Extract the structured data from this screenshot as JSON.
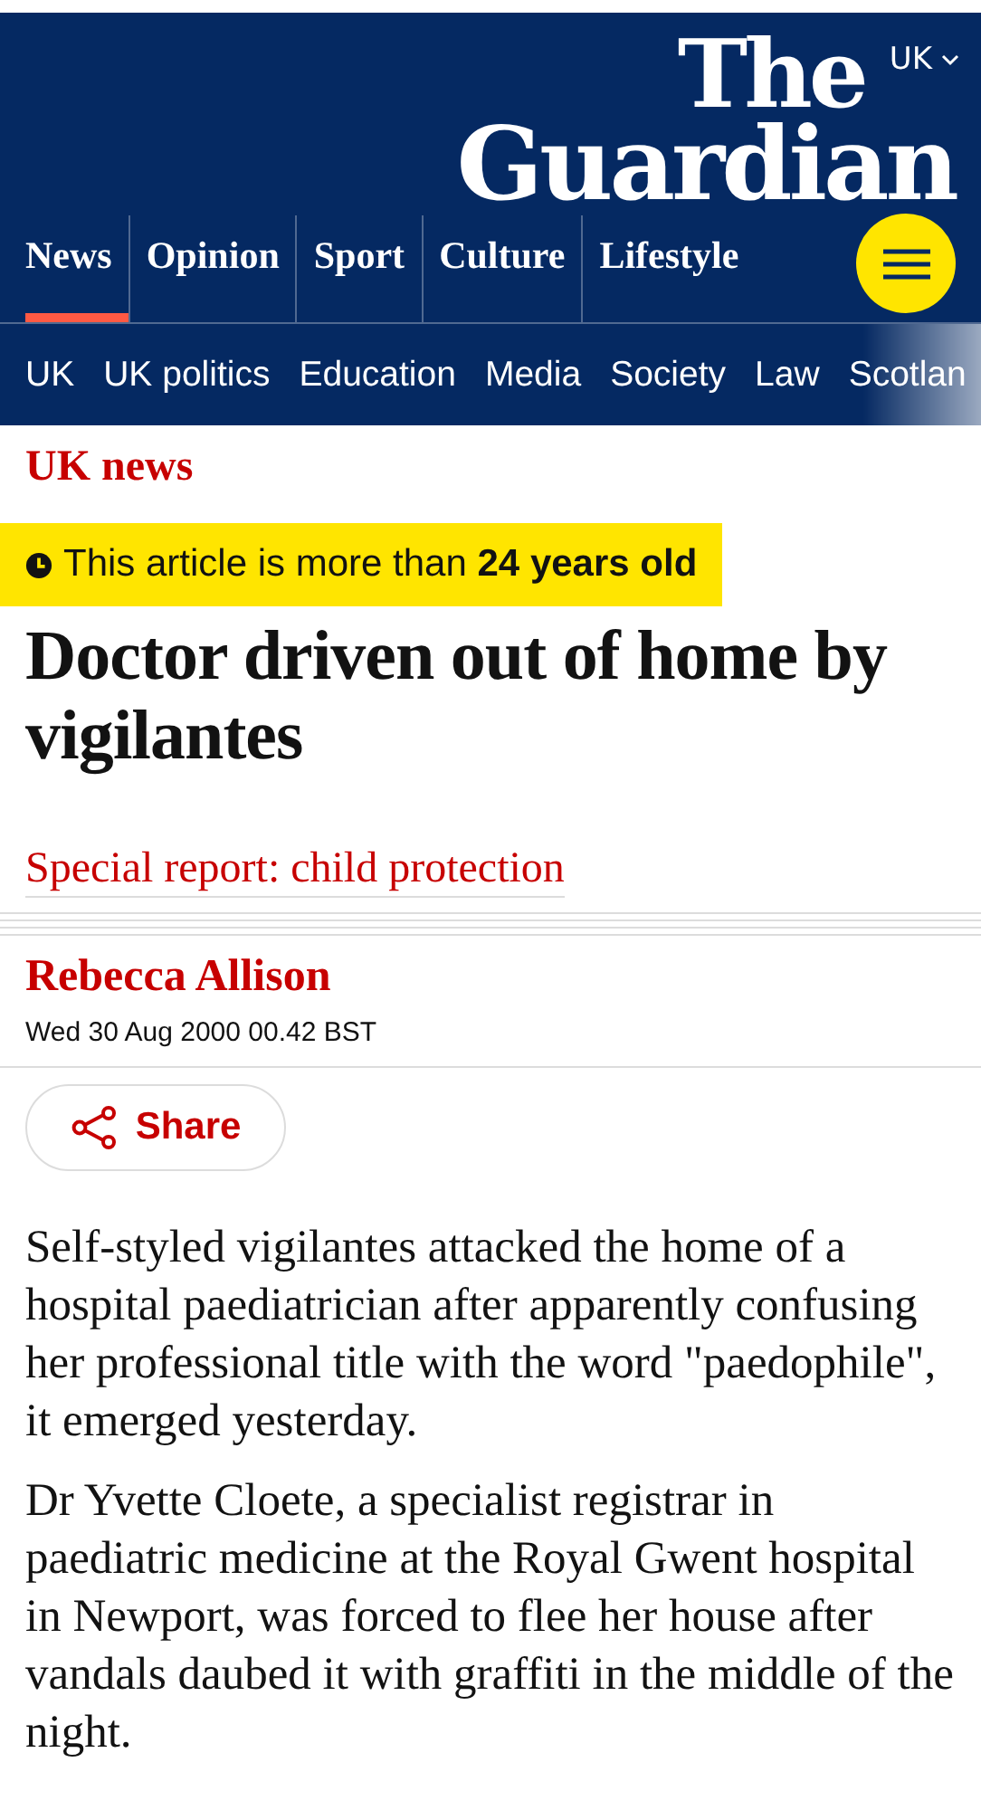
{
  "edition": {
    "label": "UK"
  },
  "logo": {
    "line1": "The",
    "line2": "Guardian"
  },
  "pillars": [
    {
      "label": "News",
      "selected": true
    },
    {
      "label": "Opinion",
      "selected": false
    },
    {
      "label": "Sport",
      "selected": false
    },
    {
      "label": "Culture",
      "selected": false
    },
    {
      "label": "Lifestyle",
      "selected": false
    }
  ],
  "subnav": [
    "UK",
    "UK politics",
    "Education",
    "Media",
    "Society",
    "Law",
    "Scotlan"
  ],
  "section": "UK news",
  "age_notice": "This article is more than **24 years old**",
  "headline": "Doctor driven out of home by vigilantes",
  "series": "Special report: child protection",
  "byline": "Rebecca Allison",
  "dateline": "Wed 30 Aug 2000 00.42 BST",
  "share": {
    "label": "Share"
  },
  "paragraphs": [
    "Self-styled vigilantes attacked the home of a hospital paediatrician after apparently confusing her professional title with the word \"paedophile\", it emerged yesterday.",
    "Dr Yvette Cloete, a specialist registrar in paediatric medicine at the Royal Gwent hospital in Newport, was forced to flee her house after vandals daubed it with graffiti in the middle of the night."
  ]
}
